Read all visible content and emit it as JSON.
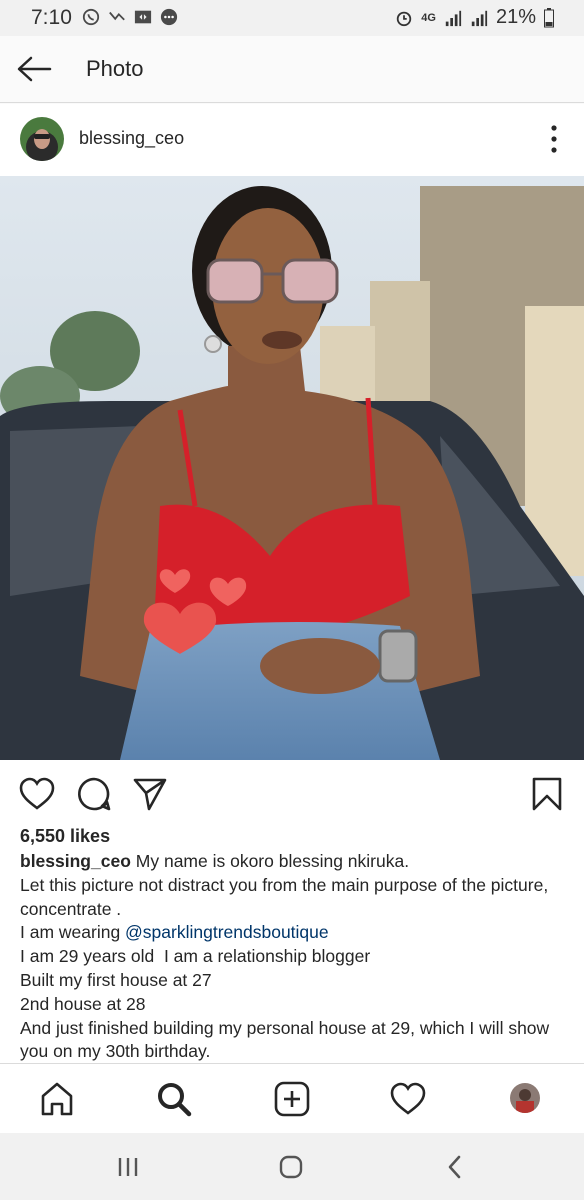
{
  "status_bar": {
    "time": "7:10",
    "network": "4G",
    "battery": "21%",
    "icons": [
      "whatsapp-icon",
      "missed-call-icon",
      "app-icon",
      "message-icon",
      "alarm-icon",
      "signal-icon",
      "signal-icon-2",
      "battery-icon"
    ]
  },
  "header": {
    "title": "Photo",
    "back_icon": "arrow-left-icon"
  },
  "post": {
    "username": "blessing_ceo",
    "more_icon": "more-vertical-icon",
    "photo_icon": "photo",
    "actions": {
      "like_icon": "heart-icon",
      "comment_icon": "comment-icon",
      "share_icon": "send-icon",
      "save_icon": "bookmark-icon"
    },
    "likes": "6,550 likes",
    "caption": {
      "username": "blessing_ceo",
      "line1": "My name is okoro blessing nkiruka.",
      "line2": "Let this picture not distract you from the main purpose of the picture, concentrate .",
      "line3_prefix": "I am wearing ",
      "mention": "@sparklingtrendsboutique",
      "line4": "I am 29 years old  I am a relationship blogger",
      "line5": "Built my first house at 27",
      "line6": "2nd house at 28",
      "line7": "And just finished building my personal house at 29, which I will show you on my 30th birthday."
    }
  },
  "bottom_nav": {
    "items": [
      "home-icon",
      "search-icon",
      "add-icon",
      "activity-icon",
      "profile-avatar"
    ]
  },
  "system_nav": {
    "items": [
      "recents-icon",
      "home-button-icon",
      "back-icon"
    ]
  },
  "colors": {
    "background": "#fafafa",
    "text": "#262626",
    "mention": "#003569",
    "divider": "#dbdbdb"
  }
}
